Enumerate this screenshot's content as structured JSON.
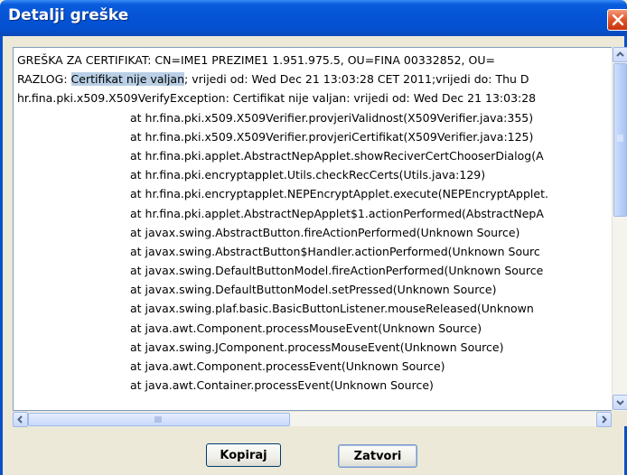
{
  "window": {
    "title": "Detalji greške"
  },
  "message": {
    "line1": "GREŠKA ZA CERTIFIKAT: CN=IME1 PREZIME1 1.951.975.5, OU=FINA 00332852, OU=",
    "line2_prefix": "RAZLOG: ",
    "line2_selected": "Certifikat nije valjan",
    "line2_suffix": "; vrijedi od: Wed Dec 21 13:03:28 CET 2011;vrijedi do: Thu D",
    "line3": "hr.fina.pki.x509.X509VerifyException: Certifikat nije valjan: vrijedi od: Wed Dec 21 13:03:28",
    "stack_trace": [
      "at hr.fina.pki.x509.X509Verifier.provjeriValidnost(X509Verifier.java:355)",
      "at hr.fina.pki.x509.X509Verifier.provjeriCertifikat(X509Verifier.java:125)",
      "at hr.fina.pki.applet.AbstractNepApplet.showReciverCertChooserDialog(A",
      "at hr.fina.pki.encryptapplet.Utils.checkRecCerts(Utils.java:129)",
      "at hr.fina.pki.encryptapplet.NEPEncryptApplet.execute(NEPEncryptApplet.",
      "at hr.fina.pki.applet.AbstractNepApplet$1.actionPerformed(AbstractNepA",
      "at javax.swing.AbstractButton.fireActionPerformed(Unknown Source)",
      "at javax.swing.AbstractButton$Handler.actionPerformed(Unknown Sourc",
      "at javax.swing.DefaultButtonModel.fireActionPerformed(Unknown Source",
      "at javax.swing.DefaultButtonModel.setPressed(Unknown Source)",
      "at javax.swing.plaf.basic.BasicButtonListener.mouseReleased(Unknown",
      "at java.awt.Component.processMouseEvent(Unknown Source)",
      "at javax.swing.JComponent.processMouseEvent(Unknown Source)",
      "at java.awt.Component.processEvent(Unknown Source)",
      "at java.awt.Container.processEvent(Unknown Source)"
    ]
  },
  "buttons": {
    "copy_label": "Kopiraj",
    "close_label": "Zatvori"
  },
  "colors": {
    "titlebar": "#0553d6",
    "selection": "#b8cfe5",
    "close_button": "#e2582e"
  }
}
